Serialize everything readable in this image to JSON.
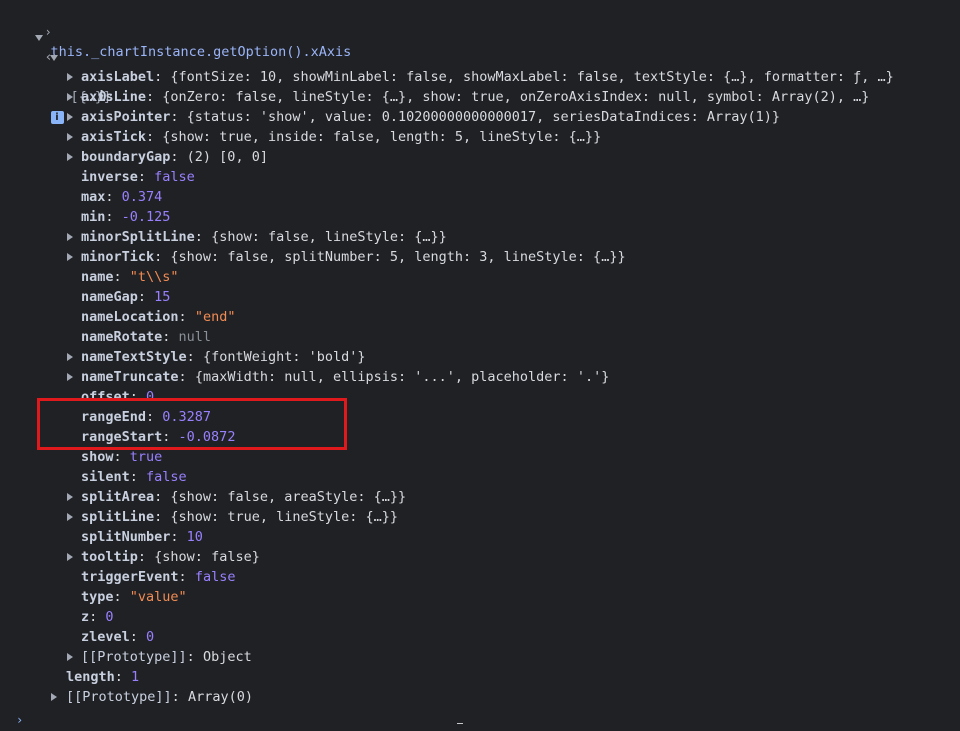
{
  "console": {
    "command": "this._chartInstance.getOption().xAxis",
    "summary": "[{…}]",
    "info_badge": "i",
    "index0": "0",
    "rows": [
      {
        "key": "axisLabel",
        "value": "{fontSize: 10, showMinLabel: false, showMaxLabel: false, textStyle: {…}, formatter: ƒ, …}"
      },
      {
        "key": "axisLine",
        "value": "{onZero: false, lineStyle: {…}, show: true, onZeroAxisIndex: null, symbol: Array(2), …}"
      },
      {
        "key": "axisPointer",
        "value": "{status: 'show', value: 0.10200000000000017, seriesDataIndices: Array(1)}"
      },
      {
        "key": "axisTick",
        "value": "{show: true, inside: false, length: 5, lineStyle: {…}}"
      },
      {
        "key": "boundaryGap",
        "value": "(2) [0, 0]"
      },
      {
        "key": "inverse",
        "value": "false"
      },
      {
        "key": "max",
        "value": "0.374"
      },
      {
        "key": "min",
        "value": "-0.125"
      },
      {
        "key": "minorSplitLine",
        "value": "{show: false, lineStyle: {…}}"
      },
      {
        "key": "minorTick",
        "value": "{show: false, splitNumber: 5, length: 3, lineStyle: {…}}"
      },
      {
        "key": "name",
        "value": "\"t\\\\s\""
      },
      {
        "key": "nameGap",
        "value": "15"
      },
      {
        "key": "nameLocation",
        "value": "\"end\""
      },
      {
        "key": "nameRotate",
        "value": "null"
      },
      {
        "key": "nameTextStyle",
        "value": "{fontWeight: 'bold'}"
      },
      {
        "key": "nameTruncate",
        "value": "{maxWidth: null, ellipsis: '...', placeholder: '.'}"
      },
      {
        "key": "offset",
        "value": "0"
      },
      {
        "key": "rangeEnd",
        "value": "0.3287"
      },
      {
        "key": "rangeStart",
        "value": "-0.0872"
      },
      {
        "key": "show",
        "value": "true"
      },
      {
        "key": "silent",
        "value": "false"
      },
      {
        "key": "splitArea",
        "value": "{show: false, areaStyle: {…}}"
      },
      {
        "key": "splitLine",
        "value": "{show: true, lineStyle: {…}}"
      },
      {
        "key": "splitNumber",
        "value": "10"
      },
      {
        "key": "tooltip",
        "value": "{show: false}"
      },
      {
        "key": "triggerEvent",
        "value": "false"
      },
      {
        "key": "type",
        "value": "\"value\""
      },
      {
        "key": "z",
        "value": "0"
      },
      {
        "key": "zlevel",
        "value": "0"
      },
      {
        "key": "[[Prototype]]",
        "value": "Object"
      }
    ],
    "length_key": "length",
    "length_value": "1",
    "proto_key": "[[Prototype]]",
    "proto_value": "Array(0)"
  },
  "colors": {
    "background": "#202124",
    "key": "#c8d0df",
    "number": "#9980ff",
    "string": "#f28b54",
    "command": "#9ab4f8",
    "highlight": "#e0191c"
  }
}
